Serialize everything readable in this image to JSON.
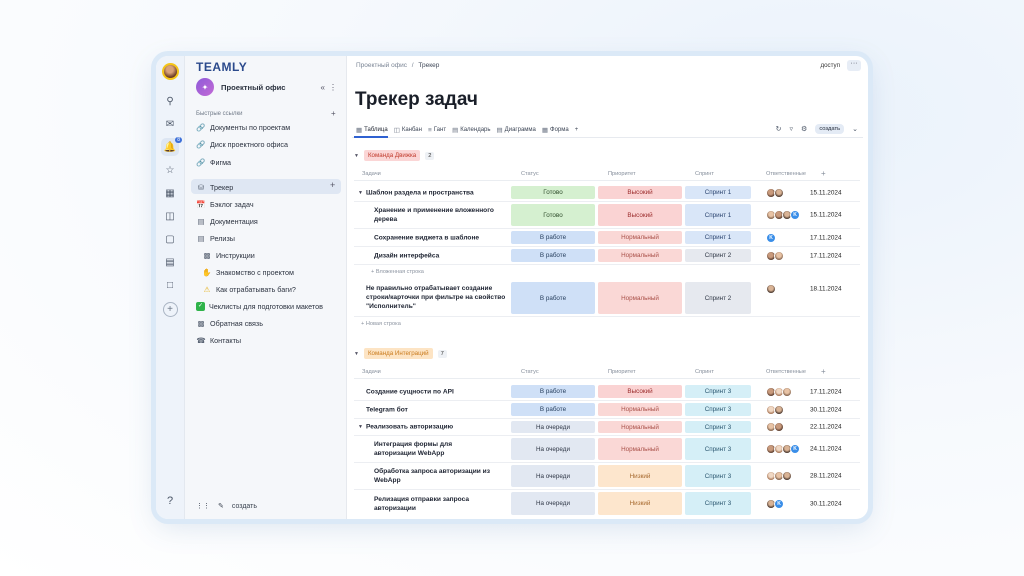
{
  "rail": {
    "icons": [
      "search-icon",
      "chat-icon",
      "bell-icon",
      "star-icon",
      "calendar-icon",
      "book-icon",
      "contacts-icon",
      "chart-icon",
      "folder-icon"
    ],
    "badge": "8",
    "help": "?"
  },
  "sidebar": {
    "logo": "TEAMLY",
    "project_name": "Проектный офис",
    "quick_links_label": "Быстрые ссылки",
    "quick_links": [
      {
        "label": "Документы по проектам",
        "icon": "link-icon"
      },
      {
        "label": "Диск проектного офиса",
        "icon": "link-icon"
      },
      {
        "label": "Фигма",
        "icon": "link-icon"
      }
    ],
    "items": [
      {
        "label": "Трекер",
        "icon": "database-icon"
      },
      {
        "label": "Бэклог задач",
        "icon": "calendar-icon"
      },
      {
        "label": "Документация",
        "icon": "doc-icon"
      },
      {
        "label": "Релизы",
        "icon": "doc-icon"
      },
      {
        "label": "Инструкции",
        "icon": "door-icon"
      },
      {
        "label": "Знакомство с проектом",
        "icon": "handshake-icon"
      },
      {
        "label": "Как отрабатывать баги?",
        "icon": "warning-icon"
      },
      {
        "label": "Чеклисты для подготовки макетов",
        "icon": "check-icon"
      },
      {
        "label": "Обратная связь",
        "icon": "building-icon"
      },
      {
        "label": "Контакты",
        "icon": "phone-icon"
      }
    ],
    "footer_create": "создать"
  },
  "header": {
    "breadcrumb_root": "Проектный офис",
    "breadcrumb_sep": "/",
    "breadcrumb_current": "Трекер",
    "access": "доступ",
    "more": "···"
  },
  "page": {
    "title": "Трекер задач",
    "views": [
      "Таблица",
      "Канбан",
      "Гант",
      "Календарь",
      "Диаграмма",
      "Форма"
    ],
    "add_view": "+",
    "create": "создать"
  },
  "columns": {
    "task": "Задачи",
    "status": "Статус",
    "priority": "Приоритет",
    "sprint": "Спринт",
    "assignees": "Ответственные"
  },
  "group1": {
    "name": "Команда Движка",
    "count": "2",
    "color": "#fbd6d6",
    "text_color": "#c0392b",
    "rows": [
      {
        "task": "Шаблон раздела и пространства",
        "status": "Готово",
        "priority": "Высокий",
        "sprint": "Спринт 1",
        "date": "15.11.2024"
      },
      {
        "task": "Хранение и применение вложенного дерева",
        "status": "Готово",
        "priority": "Высокий",
        "sprint": "Спринт 1",
        "date": "15.11.2024"
      },
      {
        "task": "Сохранение виджета в шаблоне",
        "status": "В работе",
        "priority": "Нормальный",
        "sprint": "Спринт 1",
        "date": "17.11.2024"
      },
      {
        "task": "Дизайн интерфейса",
        "status": "В работе",
        "priority": "Нормальный",
        "sprint": "Спринт 2",
        "date": "17.11.2024"
      },
      {
        "task": "Не правильно отрабатывает создание строки/карточки при фильтре на свойство \"Исполнитель\"",
        "status": "В работе",
        "priority": "Нормальный",
        "sprint": "Спринт 2",
        "date": "18.11.2024"
      }
    ],
    "nested_row": "+ Вложенная строка",
    "new_row": "+ Новая строка"
  },
  "group2": {
    "name": "Команда Интеграций",
    "count": "7",
    "color": "#fde4c4",
    "text_color": "#c97a1c",
    "rows": [
      {
        "task": "Создание сущности по API",
        "status": "В работе",
        "priority": "Высокий",
        "sprint": "Спринт 3",
        "date": "17.11.2024"
      },
      {
        "task": "Telegram бот",
        "status": "В работе",
        "priority": "Нормальный",
        "sprint": "Спринт 3",
        "date": "30.11.2024"
      },
      {
        "task": "Реализовать авторизацию",
        "status": "На очереди",
        "priority": "Нормальный",
        "sprint": "Спринт 3",
        "date": "22.11.2024"
      },
      {
        "task": "Интеграция формы для авторизации WebApp",
        "status": "На очереди",
        "priority": "Нормальный",
        "sprint": "Спринт 3",
        "date": "24.11.2024"
      },
      {
        "task": "Обработка запроса авторизации из WebApp",
        "status": "На очереди",
        "priority": "Низкий",
        "sprint": "Спринт 3",
        "date": "28.11.2024"
      },
      {
        "task": "Релизация отправки запроса авторизации",
        "status": "На очереди",
        "priority": "Низкий",
        "sprint": "Спринт 3",
        "date": "30.11.2024"
      }
    ]
  },
  "avatar_initial": "K"
}
